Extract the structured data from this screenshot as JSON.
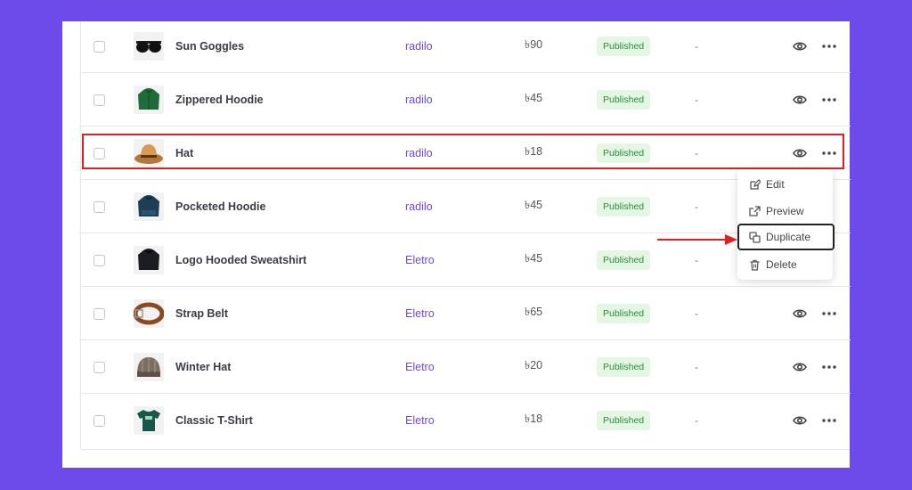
{
  "colors": {
    "background": "#6d4beb",
    "accent": "#6b48e8",
    "published_bg": "#e4f7e3",
    "published_text": "#2b8a3e",
    "highlight": "#e02020"
  },
  "products": [
    {
      "name": "Sun Goggles",
      "author": "radilo",
      "price": "৳90",
      "status": "Published",
      "extra": "-",
      "thumb_icon": "sunglasses-icon"
    },
    {
      "name": "Zippered Hoodie",
      "author": "radilo",
      "price": "৳45",
      "status": "Published",
      "extra": "-",
      "thumb_icon": "hoodie-icon"
    },
    {
      "name": "Hat",
      "author": "radilo",
      "price": "৳18",
      "status": "Published",
      "extra": "-",
      "thumb_icon": "hat-icon"
    },
    {
      "name": "Pocketed Hoodie",
      "author": "radilo",
      "price": "৳45",
      "status": "Published",
      "extra": "-",
      "thumb_icon": "hoodie-icon"
    },
    {
      "name": "Logo Hooded Sweatshirt",
      "author": "Eletro",
      "price": "৳45",
      "status": "Published",
      "extra": "-",
      "thumb_icon": "hoodie-icon"
    },
    {
      "name": "Strap Belt",
      "author": "Eletro",
      "price": "৳65",
      "status": "Published",
      "extra": "-",
      "thumb_icon": "belt-icon"
    },
    {
      "name": "Winter Hat",
      "author": "Eletro",
      "price": "৳20",
      "status": "Published",
      "extra": "-",
      "thumb_icon": "beanie-icon"
    },
    {
      "name": "Classic T-Shirt",
      "author": "Eletro",
      "price": "৳18",
      "status": "Published",
      "extra": "-",
      "thumb_icon": "tshirt-icon"
    }
  ],
  "context_menu": {
    "items": [
      {
        "label": "Edit",
        "icon": "edit-icon"
      },
      {
        "label": "Preview",
        "icon": "external-link-icon"
      },
      {
        "label": "Duplicate",
        "icon": "copy-icon"
      },
      {
        "label": "Delete",
        "icon": "trash-icon"
      }
    ],
    "active_item": "Duplicate",
    "highlighted_row": "Hat"
  }
}
